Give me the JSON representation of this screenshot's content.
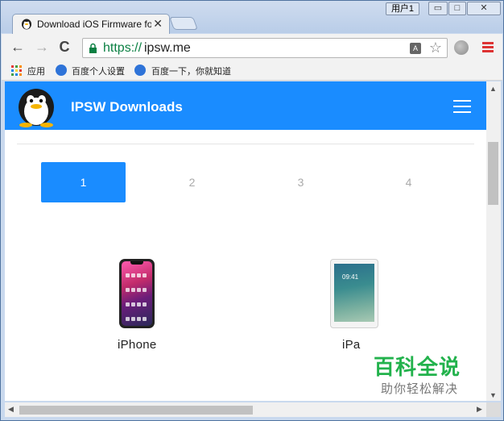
{
  "window": {
    "user_badge": "用户1",
    "minimize": "▭",
    "maximize": "□",
    "close": "✕"
  },
  "tab": {
    "title": "Download iOS Firmware for iPhone",
    "close": "✕"
  },
  "toolbar": {
    "back": "←",
    "forward": "→",
    "reload": "C",
    "url_scheme": "https://",
    "url_host": "ipsw.me",
    "translate": "A",
    "star": "☆"
  },
  "bookmarks": {
    "apps": "应用",
    "items": [
      "百度个人设置",
      "百度一下，你就知道"
    ]
  },
  "site": {
    "title": "IPSW Downloads",
    "pages": [
      "1",
      "2",
      "3",
      "4"
    ],
    "active_page": "1",
    "devices": [
      "iPhone",
      "iPa"
    ],
    "tablet_time": "09:41"
  },
  "watermark": {
    "main": "百科全说",
    "sub": "助你轻松解决"
  },
  "scrollbars": {
    "up": "▲",
    "down": "▼",
    "left": "◀",
    "right": "▶"
  },
  "colors": {
    "header_blue": "#1a8cff",
    "secure_green": "#0b8043",
    "watermark_green": "#22b24c"
  }
}
